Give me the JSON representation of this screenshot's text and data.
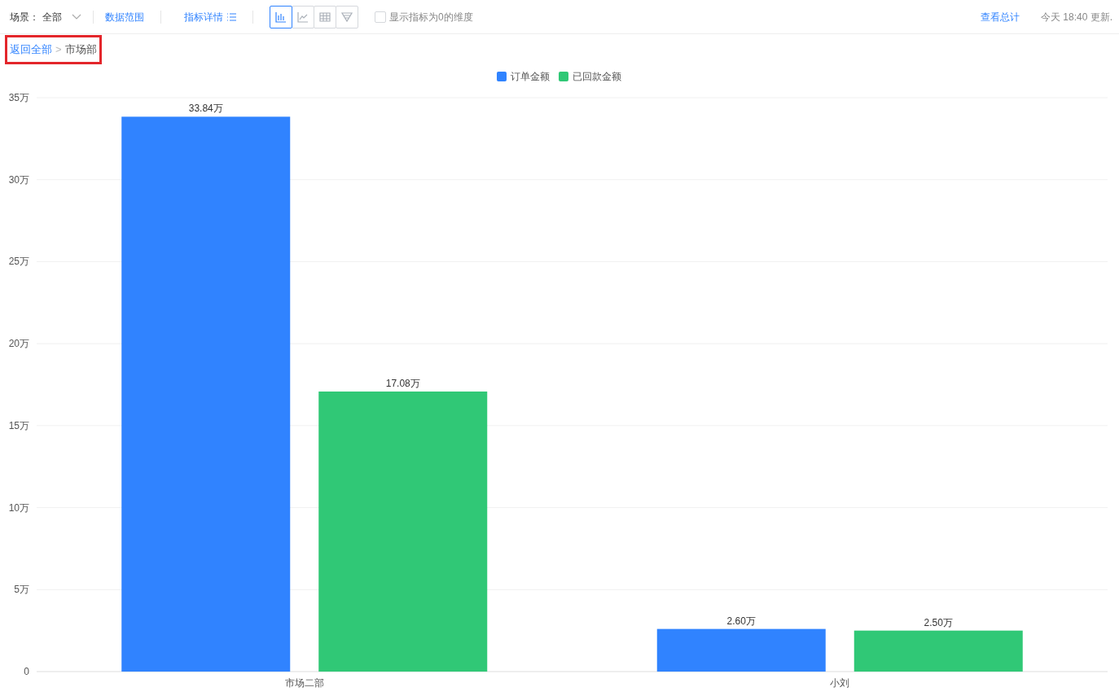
{
  "toolbar": {
    "scene_label": "场景：",
    "scene_value": "全部",
    "data_range": "数据范围",
    "metric_detail": "指标详情",
    "chart_types": [
      {
        "kind": "bar",
        "selected": true
      },
      {
        "kind": "line",
        "selected": false
      },
      {
        "kind": "table",
        "selected": false
      },
      {
        "kind": "funnel",
        "selected": false
      }
    ],
    "zero_option": {
      "label": "显示指标为0的维度",
      "checked": false
    },
    "view_total": "查看总计",
    "updated": "今天 18:40 更新."
  },
  "breadcrumb": {
    "root": "返回全部",
    "separator": ">",
    "current": "市场部"
  },
  "chart": {
    "chart_data": {
      "type": "bar",
      "categories": [
        "市场二部",
        "小刘"
      ],
      "series": [
        {
          "name": "订单金额",
          "color": "#3083ff",
          "values": [
            33.84,
            2.6
          ]
        },
        {
          "name": "已回款金额",
          "color": "#30c876",
          "values": [
            17.08,
            2.5
          ]
        }
      ],
      "ylim": [
        0,
        35
      ],
      "grid": true,
      "legend": "top",
      "yticks": [
        {
          "value": 0,
          "label": "0"
        },
        {
          "value": 5,
          "label": "5万"
        },
        {
          "value": 10,
          "label": "10万"
        },
        {
          "value": 15,
          "label": "15万"
        },
        {
          "value": 20,
          "label": "20万"
        },
        {
          "value": 25,
          "label": "25万"
        },
        {
          "value": 30,
          "label": "30万"
        },
        {
          "value": 35,
          "label": "35万"
        }
      ],
      "value_labels": [
        [
          "33.84万",
          "2.60万"
        ],
        [
          "17.08万",
          "2.50万"
        ]
      ]
    }
  }
}
